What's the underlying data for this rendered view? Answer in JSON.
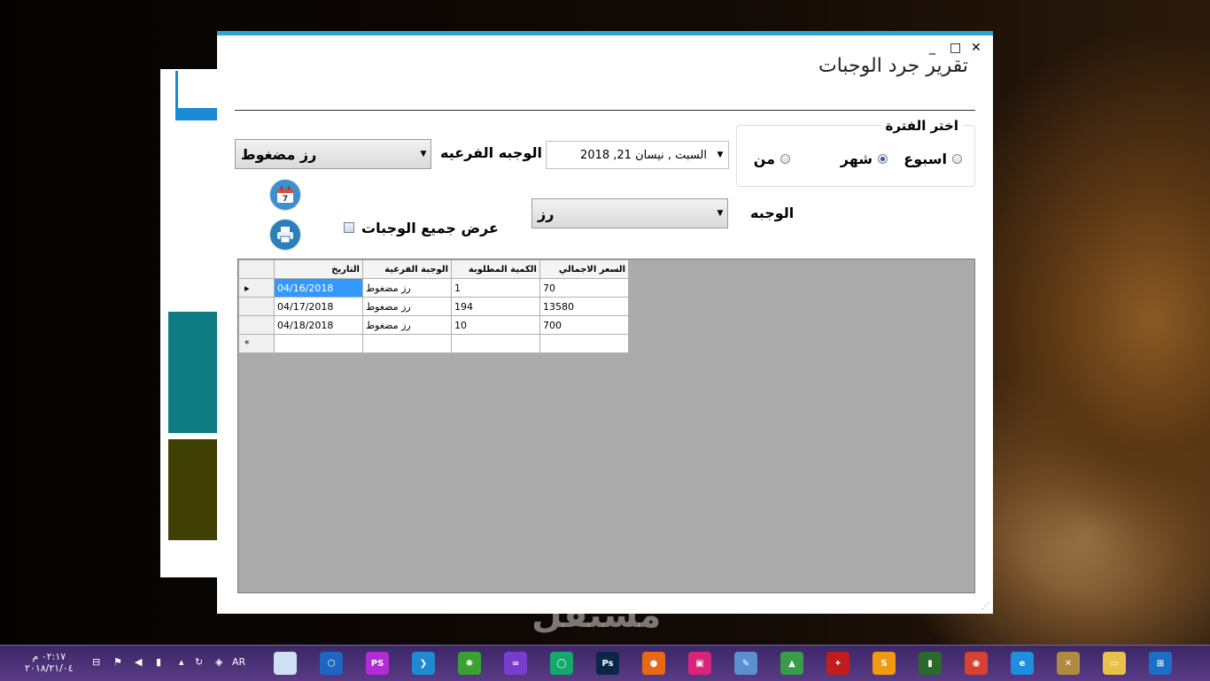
{
  "window": {
    "title": "تقرير جرد الوجبات",
    "controls": {
      "minimize": "_",
      "maximize": "□",
      "close": "✕"
    }
  },
  "period_group": {
    "title": "اختر الفترة",
    "options": [
      {
        "label": "اسبوع",
        "checked": false
      },
      {
        "label": "شهر",
        "checked": true
      },
      {
        "label": "من",
        "checked": false
      }
    ]
  },
  "date_picker": {
    "value": "السبت ,    نيسان 21, 2018"
  },
  "sub_meal": {
    "label": "الوجبه الفرعيه",
    "value": "رز مضغوط"
  },
  "meal": {
    "label": "الوجبه",
    "value": "رز"
  },
  "show_all": {
    "label": "عرض جميع الوجبات",
    "checked": false
  },
  "calendar_button": {
    "day": "7"
  },
  "grid": {
    "columns": [
      "التاريخ",
      "الوجبة الفرعية",
      "الكمية المطلوبة",
      "السعر الاجمالي"
    ],
    "rows": [
      {
        "marker": "▸",
        "date": "04/16/2018",
        "sub_meal": "رز مضغوط",
        "quantity": "1",
        "total": "70"
      },
      {
        "marker": "",
        "date": "04/17/2018",
        "sub_meal": "رز مضغوط",
        "quantity": "194",
        "total": "13580"
      },
      {
        "marker": "",
        "date": "04/18/2018",
        "sub_meal": "رز مضغوط",
        "quantity": "10",
        "total": "700"
      }
    ],
    "new_row_marker": "*"
  },
  "taskbar": {
    "time": "٠٢:١٧ م",
    "date": "٢٠١٨/٢١/٠٤",
    "language": "AR",
    "apps": [
      {
        "name": "window-app-icon",
        "text": "",
        "color": "#cfe0f4"
      },
      {
        "name": "hex-app-icon",
        "text": "⬡",
        "color": "#1e66c2"
      },
      {
        "name": "phpstorm-icon",
        "text": "PS",
        "color": "#b12bd6"
      },
      {
        "name": "vscode-icon",
        "text": "❯",
        "color": "#1f8ad2"
      },
      {
        "name": "gecko-icon",
        "text": "✺",
        "color": "#3aa233"
      },
      {
        "name": "visual-studio-icon",
        "text": "∞",
        "color": "#7a3ccc"
      },
      {
        "name": "circle-app-icon",
        "text": "◯",
        "color": "#14a86c"
      },
      {
        "name": "photoshop-icon",
        "text": "Ps",
        "color": "#0a2846"
      },
      {
        "name": "firefox-icon",
        "text": "●",
        "color": "#e66a16"
      },
      {
        "name": "pink-app-icon",
        "text": "▣",
        "color": "#d8247a"
      },
      {
        "name": "paint-icon",
        "text": "✎",
        "color": "#5c8fd0"
      },
      {
        "name": "android-studio-icon",
        "text": "▲",
        "color": "#3a9b4a"
      },
      {
        "name": "red-app-icon",
        "text": "✦",
        "color": "#c21c1c"
      },
      {
        "name": "sublime-icon",
        "text": "S",
        "color": "#f09a12"
      },
      {
        "name": "camtasia-icon",
        "text": "▮",
        "color": "#2a6a2a"
      },
      {
        "name": "chrome-icon",
        "text": "◉",
        "color": "#d64231"
      },
      {
        "name": "ie-icon",
        "text": "e",
        "color": "#1e8ee0"
      },
      {
        "name": "tools-icon",
        "text": "✕",
        "color": "#b08a40"
      },
      {
        "name": "folder-icon",
        "text": "▭",
        "color": "#e8c04a"
      },
      {
        "name": "start-icon",
        "text": "⊞",
        "color": "#1a6fc8"
      }
    ]
  }
}
